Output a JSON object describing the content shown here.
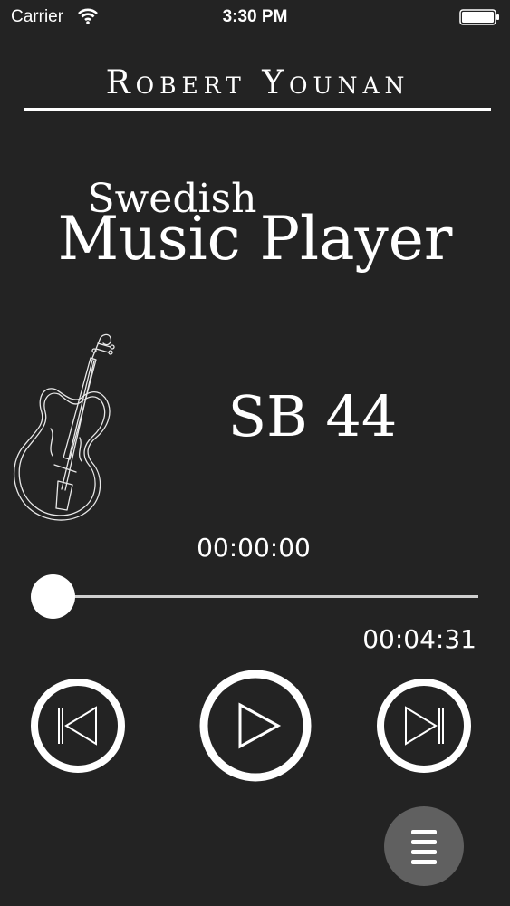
{
  "status_bar": {
    "carrier": "Carrier",
    "time": "3:30 PM",
    "icons": [
      "wifi-icon",
      "battery-icon"
    ]
  },
  "header": {
    "artist": "Robert Younan",
    "subtitle": "Swedish",
    "title": "Music Player"
  },
  "now_playing": {
    "song": "SB 44",
    "art_icon": "violin-icon"
  },
  "playback": {
    "current_time": "00:00:00",
    "total_time": "00:04:31",
    "progress": 0.0
  },
  "controls": {
    "icons": [
      "previous-track-icon",
      "play-icon",
      "next-track-icon"
    ]
  },
  "menu": {
    "icon": "menu-icon"
  },
  "colors": {
    "background": "#232323",
    "foreground": "#ffffff",
    "menu_button": "#606060",
    "track": "#cfcfcf"
  }
}
